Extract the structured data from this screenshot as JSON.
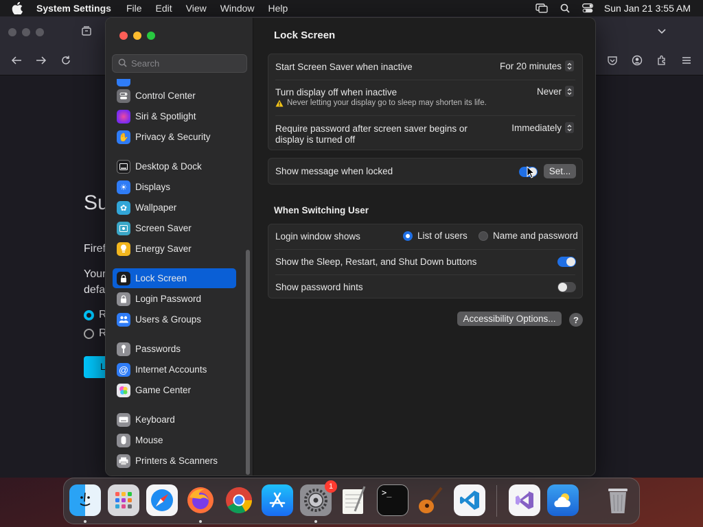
{
  "menubar": {
    "app_name": "System Settings",
    "menus": [
      "File",
      "Edit",
      "View",
      "Window",
      "Help"
    ],
    "clock": "Sun Jan 21  3:55 AM",
    "icons": [
      "apple-icon",
      "screen-mirroring-icon",
      "spotlight-search-icon",
      "control-center-icon"
    ]
  },
  "browser": {
    "heading_fragment": "Su",
    "text_1": "Firef",
    "text_2": "Your",
    "text_3": "defa",
    "radio_1": "R",
    "radio_2": "R",
    "cta": "L"
  },
  "sidebar": {
    "search_placeholder": "Search",
    "items": [
      {
        "label": "Control Center",
        "icon": "control-center-icon",
        "color": "#6e6e73"
      },
      {
        "label": "Siri & Spotlight",
        "icon": "siri-icon",
        "color": "#b23bd0"
      },
      {
        "label": "Privacy & Security",
        "icon": "hand-icon",
        "color": "#2f7cf6"
      },
      {
        "label": "Desktop & Dock",
        "icon": "dock-icon",
        "color": "#1c1c1e"
      },
      {
        "label": "Displays",
        "icon": "sun-icon",
        "color": "#2f7cf6"
      },
      {
        "label": "Wallpaper",
        "icon": "flower-icon",
        "color": "#32a6d8"
      },
      {
        "label": "Screen Saver",
        "icon": "screen-saver-icon",
        "color": "#3aa7c7"
      },
      {
        "label": "Energy Saver",
        "icon": "bulb-icon",
        "color": "#f2b61e"
      },
      {
        "label": "Lock Screen",
        "icon": "lock-icon",
        "color": "#1c1c1e"
      },
      {
        "label": "Login Password",
        "icon": "lock-icon",
        "color": "#8e8e93"
      },
      {
        "label": "Users & Groups",
        "icon": "users-icon",
        "color": "#2f7cf6"
      },
      {
        "label": "Passwords",
        "icon": "key-icon",
        "color": "#8e8e93"
      },
      {
        "label": "Internet Accounts",
        "icon": "at-icon",
        "color": "#2f7cf6"
      },
      {
        "label": "Game Center",
        "icon": "game-center-icon",
        "color": "#e9e9ee"
      },
      {
        "label": "Keyboard",
        "icon": "keyboard-icon",
        "color": "#8e8e93"
      },
      {
        "label": "Mouse",
        "icon": "mouse-icon",
        "color": "#8e8e93"
      },
      {
        "label": "Printers & Scanners",
        "icon": "printer-icon",
        "color": "#8e8e93"
      }
    ],
    "active": "Lock Screen"
  },
  "content": {
    "title": "Lock Screen",
    "screen_saver": {
      "label": "Start Screen Saver when inactive",
      "value": "For 20 minutes"
    },
    "display_off": {
      "label": "Turn display off when inactive",
      "value": "Never",
      "warning": "Never letting your display go to sleep may shorten its life."
    },
    "require_password": {
      "label_line1": "Require password after screen saver begins or",
      "label_line2": "display is turned off",
      "value": "Immediately"
    },
    "show_message": {
      "label": "Show message when locked",
      "enabled": true,
      "button": "Set..."
    },
    "switching_title": "When Switching User",
    "login_window": {
      "label": "Login window shows",
      "options": [
        "List of users",
        "Name and password"
      ],
      "selected": "List of users"
    },
    "sleep_buttons": {
      "label": "Show the Sleep, Restart, and Shut Down buttons",
      "enabled": true
    },
    "password_hints": {
      "label": "Show password hints",
      "enabled": false
    },
    "accessibility_button": "Accessibility Options...",
    "help_button": "?"
  },
  "dock": {
    "apps": [
      {
        "name": "Finder",
        "icon": "finder-icon",
        "running": true
      },
      {
        "name": "Launchpad",
        "icon": "launchpad-icon",
        "running": false
      },
      {
        "name": "Safari",
        "icon": "safari-icon",
        "running": false
      },
      {
        "name": "Firefox",
        "icon": "firefox-icon",
        "running": true
      },
      {
        "name": "Chrome",
        "icon": "chrome-icon",
        "running": false
      },
      {
        "name": "App Store",
        "icon": "app-store-icon",
        "running": false
      },
      {
        "name": "System Settings",
        "icon": "system-settings-icon",
        "running": true,
        "badge": "1"
      },
      {
        "name": "TextEdit",
        "icon": "textedit-icon",
        "running": false
      },
      {
        "name": "Terminal",
        "icon": "terminal-icon",
        "running": false
      },
      {
        "name": "GarageBand",
        "icon": "guitar-icon",
        "running": false
      },
      {
        "name": "VS Code",
        "icon": "vscode-icon",
        "running": false
      },
      {
        "name": "Visual Studio",
        "icon": "visual-studio-icon",
        "running": false
      },
      {
        "name": "Weather",
        "icon": "weather-icon",
        "running": false
      },
      {
        "name": "Trash",
        "icon": "trash-icon",
        "running": false
      }
    ]
  },
  "colors": {
    "accent": "#0a5fd6",
    "toggle_on": "#1f6fe5",
    "warning": "#f5c518",
    "badge": "#ff3b30"
  }
}
